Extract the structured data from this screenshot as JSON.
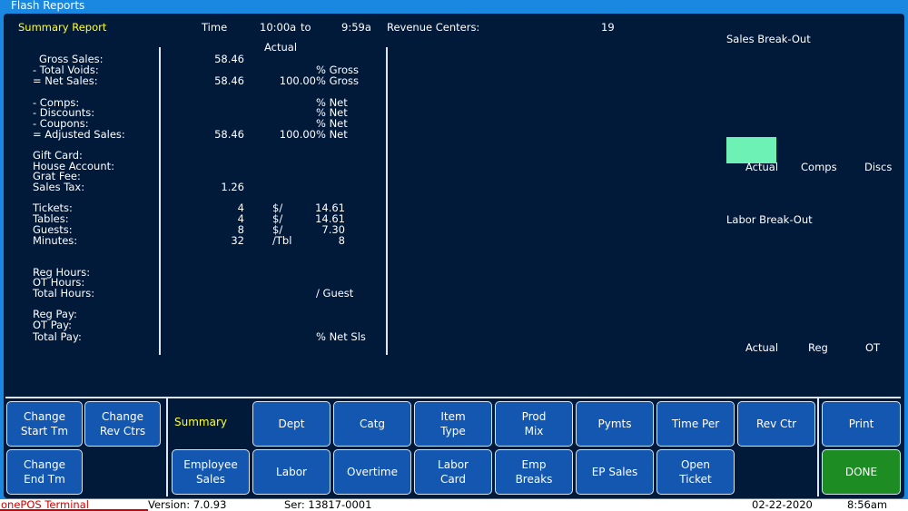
{
  "window": {
    "title": "Flash Reports"
  },
  "header": {
    "report_title": "Summary Report",
    "time_label": "Time",
    "time_from": "10:00a",
    "time_to_label": "to",
    "time_to": "9:59a",
    "rev_centers_label": "Revenue Centers:",
    "rev_centers_value": "19",
    "actual_heading": "Actual"
  },
  "report": {
    "gross_sales": {
      "label": "Gross Sales:",
      "value": "58.46"
    },
    "total_voids": {
      "label": "- Total Voids:",
      "pct_label": "% Gross"
    },
    "net_sales": {
      "label": "= Net Sales:",
      "value": "58.46",
      "pct": "100.00",
      "pct_label": "% Gross"
    },
    "comps": {
      "label": "- Comps:",
      "pct_label": "% Net"
    },
    "discounts": {
      "label": "- Discounts:",
      "pct_label": "% Net"
    },
    "coupons": {
      "label": "- Coupons:",
      "pct_label": "% Net"
    },
    "adjusted_sales": {
      "label": "= Adjusted Sales:",
      "value": "58.46",
      "pct": "100.00",
      "pct_label": "% Net"
    },
    "gift_card": {
      "label": "Gift Card:"
    },
    "house_account": {
      "label": "House Account:"
    },
    "grat_fee": {
      "label": "Grat Fee:"
    },
    "sales_tax": {
      "label": "Sales Tax:",
      "value": "1.26"
    },
    "tickets": {
      "label": "Tickets:",
      "value": "4",
      "unit": "$/",
      "ratio": "14.61"
    },
    "tables": {
      "label": "Tables:",
      "value": "4",
      "unit": "$/",
      "ratio": "14.61"
    },
    "guests": {
      "label": "Guests:",
      "value": "8",
      "unit": "$/",
      "ratio": "7.30"
    },
    "minutes": {
      "label": "Minutes:",
      "value": "32",
      "unit": "/Tbl",
      "ratio": "8"
    },
    "reg_hours": {
      "label": "Reg Hours:"
    },
    "ot_hours": {
      "label": "OT Hours:"
    },
    "total_hours": {
      "label": "Total Hours:",
      "pct_label": "/ Guest"
    },
    "reg_pay": {
      "label": "Reg Pay:"
    },
    "ot_pay": {
      "label": "OT Pay:"
    },
    "total_pay": {
      "label": "Total Pay:",
      "pct_label": "% Net Sls"
    }
  },
  "sales_breakout": {
    "title": "Sales Break-Out",
    "legend": [
      "Actual",
      "Comps",
      "Discs"
    ],
    "actual_color": "#6df1b4"
  },
  "labor_breakout": {
    "title": "Labor Break-Out",
    "legend": [
      "Actual",
      "Reg",
      "OT"
    ]
  },
  "buttons": {
    "change_start": "Change\nStart Tm",
    "change_rev": "Change\nRev Ctrs",
    "change_end": "Change\nEnd Tm",
    "summary": "Summary",
    "dept": "Dept",
    "catg": "Catg",
    "item_type": "Item\nType",
    "prod_mix": "Prod\nMix",
    "pymts": "Pymts",
    "time_per": "Time Per",
    "rev_ctr": "Rev Ctr",
    "print": "Print",
    "employee_sales": "Employee\nSales",
    "labor": "Labor",
    "overtime": "Overtime",
    "labor_card": "Labor\nCard",
    "emp_breaks": "Emp\nBreaks",
    "ep_sales": "EP Sales",
    "open_ticket": "Open\nTicket",
    "done": "DONE"
  },
  "status_bar": {
    "app": "onePOS Terminal",
    "version": "Version: 7.0.93",
    "serial": "Ser: 13817-0001",
    "date": "02-22-2020",
    "time": "8:56am"
  },
  "colors": {
    "accent": "#1a88e0",
    "background": "#021a3a",
    "button": "#1457b0",
    "done_button": "#1d8c23",
    "highlight_text": "#ffff33"
  }
}
